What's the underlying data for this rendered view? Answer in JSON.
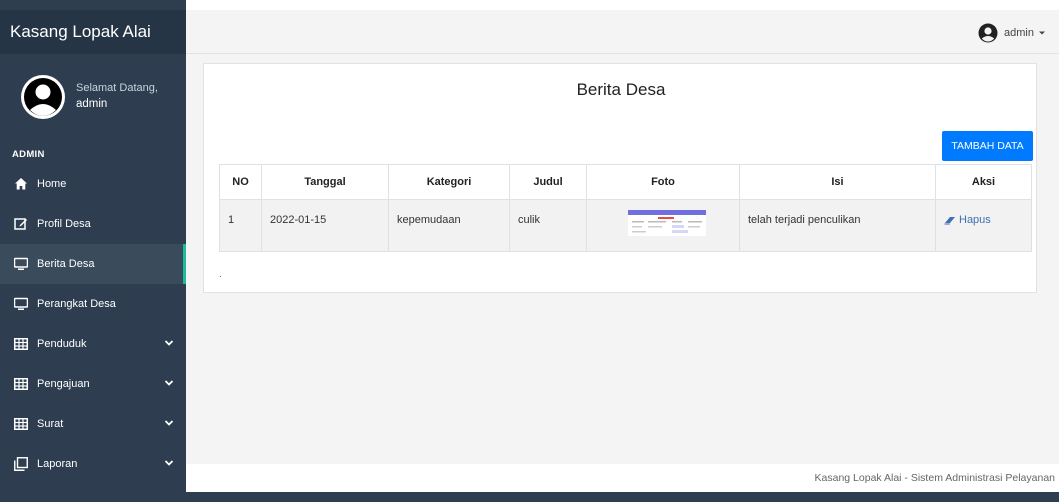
{
  "brand": "Kasang Lopak Alai",
  "user_panel": {
    "greeting": "Selamat Datang,",
    "username": "admin"
  },
  "section_header": "ADMIN",
  "nav": [
    {
      "label": "Home",
      "icon": "home-icon",
      "chevron": false
    },
    {
      "label": "Profil Desa",
      "icon": "edit-icon",
      "chevron": false
    },
    {
      "label": "Berita Desa",
      "icon": "monitor-icon",
      "chevron": false,
      "active": true
    },
    {
      "label": "Perangkat Desa",
      "icon": "monitor-icon",
      "chevron": false
    },
    {
      "label": "Penduduk",
      "icon": "table-icon",
      "chevron": true
    },
    {
      "label": "Pengajuan",
      "icon": "table-icon",
      "chevron": true
    },
    {
      "label": "Surat",
      "icon": "table-icon",
      "chevron": true
    },
    {
      "label": "Laporan",
      "icon": "copy-icon",
      "chevron": true
    }
  ],
  "topbar": {
    "user_label": "admin"
  },
  "card": {
    "title": "Berita Desa",
    "add_button": "TAMBAH DATA",
    "columns": [
      "NO",
      "Tanggal",
      "Kategori",
      "Judul",
      "Foto",
      "Isi",
      "Aksi"
    ],
    "rows": [
      {
        "no": "1",
        "tanggal": "2022-01-15",
        "kategori": "kepemudaan",
        "judul": "culik",
        "isi": "telah terjadi penculikan",
        "aksi": "Hapus"
      }
    ],
    "below_text": "."
  },
  "footer": "Kasang Lopak Alai - Sistem Administrasi Pelayanan",
  "colors": {
    "sidebar": "#2e3e50",
    "accent": "#1abc9c",
    "primary_button": "#007bff"
  }
}
